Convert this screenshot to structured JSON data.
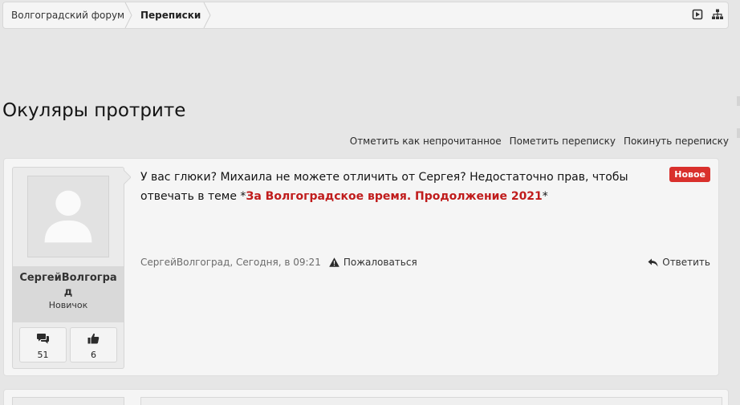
{
  "breadcrumb": {
    "home": "Волгоградский форум",
    "current": "Переписки"
  },
  "conversation": {
    "title": "Окуляры протрите"
  },
  "actions": {
    "mark_unread": "Отметить как непрочитанное",
    "flag": "Пометить переписку",
    "leave": "Покинуть переписку"
  },
  "message": {
    "username": "СергейВолгоград",
    "user_title": "Новичок",
    "messages_count": "51",
    "likes_count": "6",
    "badge": "Новое",
    "text_prefix": "У вас глюки? Михаила не можете отличить от Сергея? Недостаточно прав, чтобы отвечать в теме *",
    "thread_link": "За Волгоградское время. Продолжение 2021",
    "text_suffix": "*",
    "meta": "СергейВолгоград, Сегодня, в 09:21",
    "report_label": "Пожаловаться",
    "reply_label": "Ответить"
  },
  "icons": {
    "toolbar": [
      "play-square-icon",
      "sitemap-icon"
    ],
    "avatar": "default-avatar-icon",
    "stats": [
      "comments-icon",
      "thumbs-up-icon"
    ],
    "report": "warning-icon",
    "reply": "reply-icon"
  },
  "colors": {
    "badge": "#d9302c",
    "link": "#c01c1c",
    "page_bg": "#e6e6e6"
  }
}
